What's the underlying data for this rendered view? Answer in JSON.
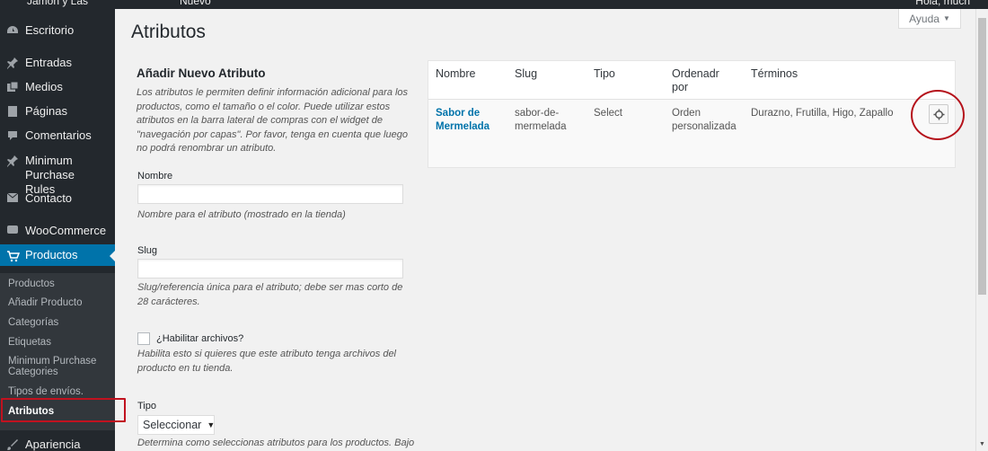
{
  "admin_bar": {
    "site_name": "Jamon y Las",
    "new_label": "Nuevo",
    "howdy": "Hola, mucn"
  },
  "sidebar": {
    "items": [
      {
        "label": "Escritorio",
        "icon": "dashboard-icon"
      },
      {
        "label": "Entradas",
        "icon": "pin-icon"
      },
      {
        "label": "Medios",
        "icon": "media-icon"
      },
      {
        "label": "Páginas",
        "icon": "page-icon"
      },
      {
        "label": "Comentarios",
        "icon": "comment-icon"
      },
      {
        "label": "Minimum Purchase Rules",
        "icon": "pin-icon"
      },
      {
        "label": "Contacto",
        "icon": "mail-icon"
      },
      {
        "label": "WooCommerce",
        "icon": "woo-icon"
      },
      {
        "label": "Productos",
        "icon": "cart-icon"
      },
      {
        "label": "Apariencia",
        "icon": "brush-icon"
      }
    ],
    "submenu": [
      "Productos",
      "Añadir Producto",
      "Categorías",
      "Etiquetas",
      "Minimum Purchase Categories",
      "Tipos de envíos.",
      "Atributos"
    ]
  },
  "page": {
    "title": "Atributos",
    "help_tab": "Ayuda"
  },
  "form": {
    "title": "Añadir Nuevo Atributo",
    "intro": "Los atributos le permiten definir información adicional para los productos, como el tamaño o el color. Puede utilizar estos atributos en la barra lateral de compras con el widget de \"navegación por capas\". Por favor, tenga en cuenta que luego no podrá renombrar un atributo.",
    "name_label": "Nombre",
    "name_value": "",
    "name_help": "Nombre para el atributo (mostrado en la tienda)",
    "slug_label": "Slug",
    "slug_value": "",
    "slug_help": "Slug/referencia única para el atributo; debe ser mas corto de 28 carácteres.",
    "archives_label": "¿Habilitar archivos?",
    "archives_help": "Habilita esto si quieres que este atributo tenga archivos del producto en tu tienda.",
    "type_label": "Tipo",
    "type_value": "Seleccionar",
    "type_help": "Determina como seleccionas atributos para los productos. Bajo el"
  },
  "table": {
    "headers": [
      "Nombre",
      "Slug",
      "Tipo",
      "Ordenadr por",
      "Términos"
    ],
    "rows": [
      {
        "name": "Sabor de Mermelada",
        "slug": "sabor-de-mermelada",
        "type": "Select",
        "order": "Orden personalizada",
        "terms": "Durazno, Frutilla, Higo, Zapallo"
      }
    ]
  },
  "colors": {
    "sidebar_bg": "#23282d",
    "accent": "#0073aa",
    "annotation_red": "#c1121f"
  }
}
